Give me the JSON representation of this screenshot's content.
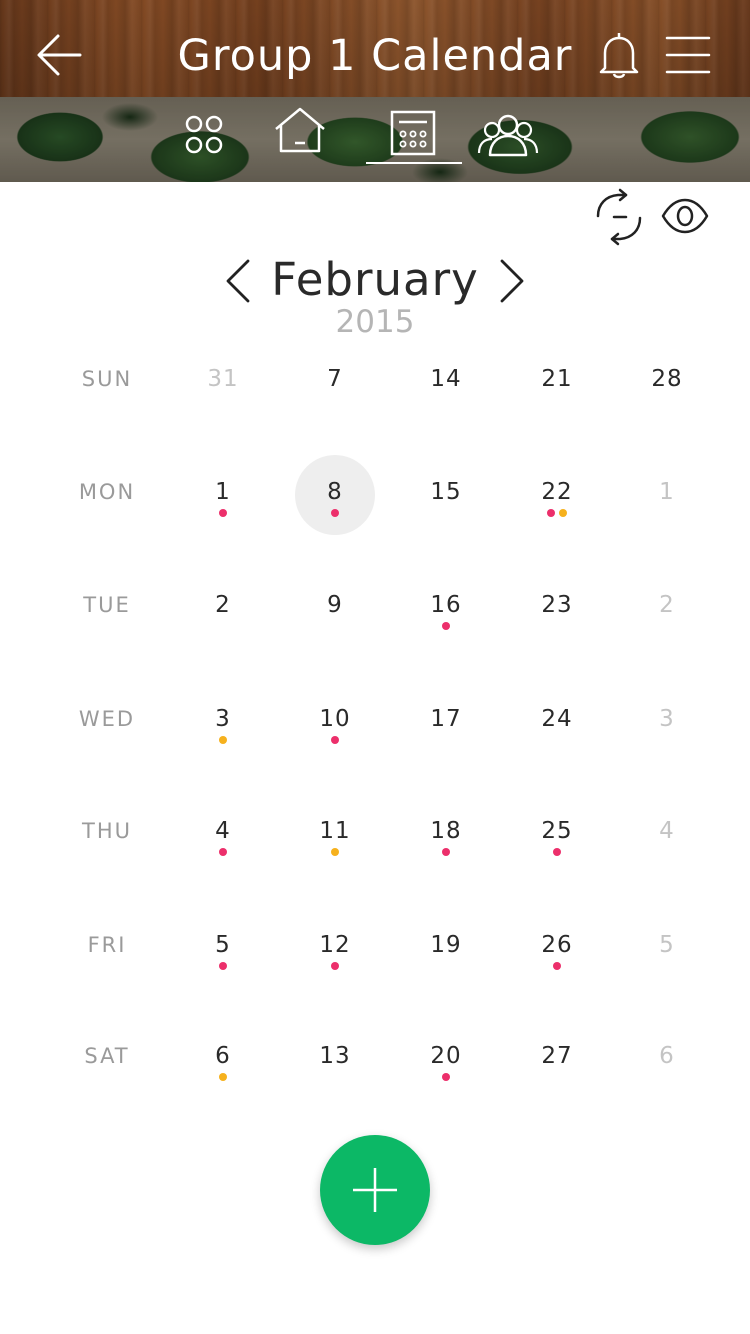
{
  "header": {
    "title": "Group 1 Calendar",
    "icons": [
      "back-arrow-icon",
      "bell-icon",
      "hamburger-menu-icon"
    ]
  },
  "nav": {
    "tabs": [
      {
        "name": "apps",
        "icon": "four-circles-icon"
      },
      {
        "name": "home",
        "icon": "house-icon"
      },
      {
        "name": "calendar",
        "icon": "calendar-icon",
        "active": true
      },
      {
        "name": "groups",
        "icon": "people-icon"
      }
    ]
  },
  "tools": {
    "icons": [
      "sync-icon",
      "eye-icon"
    ]
  },
  "calendar": {
    "month": "February",
    "year": "2015",
    "day_labels": [
      "SUN",
      "MON",
      "TUE",
      "WED",
      "THU",
      "FRI",
      "SAT"
    ],
    "weeks": [
      [
        {
          "n": "31",
          "muted": true,
          "dots": []
        },
        {
          "n": "1",
          "dots": [
            "pink"
          ]
        },
        {
          "n": "2",
          "dots": []
        },
        {
          "n": "3",
          "dots": [
            "orange"
          ]
        },
        {
          "n": "4",
          "dots": [
            "pink"
          ]
        },
        {
          "n": "5",
          "dots": [
            "pink"
          ]
        },
        {
          "n": "6",
          "dots": [
            "orange"
          ]
        }
      ],
      [
        {
          "n": "7",
          "dots": []
        },
        {
          "n": "8",
          "today": true,
          "dots": [
            "pink"
          ]
        },
        {
          "n": "9",
          "dots": []
        },
        {
          "n": "10",
          "dots": [
            "pink"
          ]
        },
        {
          "n": "11",
          "dots": [
            "orange"
          ]
        },
        {
          "n": "12",
          "dots": [
            "pink"
          ]
        },
        {
          "n": "13",
          "dots": []
        }
      ],
      [
        {
          "n": "14",
          "dots": []
        },
        {
          "n": "15",
          "dots": []
        },
        {
          "n": "16",
          "dots": [
            "pink"
          ]
        },
        {
          "n": "17",
          "dots": []
        },
        {
          "n": "18",
          "dots": [
            "pink"
          ]
        },
        {
          "n": "19",
          "dots": []
        },
        {
          "n": "20",
          "dots": [
            "pink"
          ]
        }
      ],
      [
        {
          "n": "21",
          "dots": []
        },
        {
          "n": "22",
          "dots": [
            "pink",
            "orange"
          ]
        },
        {
          "n": "23",
          "dots": []
        },
        {
          "n": "24",
          "dots": []
        },
        {
          "n": "25",
          "dots": [
            "pink"
          ]
        },
        {
          "n": "26",
          "dots": [
            "pink"
          ]
        },
        {
          "n": "27",
          "dots": []
        }
      ],
      [
        {
          "n": "28",
          "dots": []
        },
        {
          "n": "1",
          "muted": true,
          "dots": []
        },
        {
          "n": "2",
          "muted": true,
          "dots": []
        },
        {
          "n": "3",
          "muted": true,
          "dots": []
        },
        {
          "n": "4",
          "muted": true,
          "dots": []
        },
        {
          "n": "5",
          "muted": true,
          "dots": []
        },
        {
          "n": "6",
          "muted": true,
          "dots": []
        }
      ]
    ]
  },
  "colors": {
    "event_pink": "#ec2f6b",
    "event_orange": "#f6b11d",
    "fab_green": "#0cb866",
    "today_bg": "#eeeeee",
    "muted_text": "#c4c4c4"
  },
  "fab": {
    "icon": "plus-icon"
  }
}
